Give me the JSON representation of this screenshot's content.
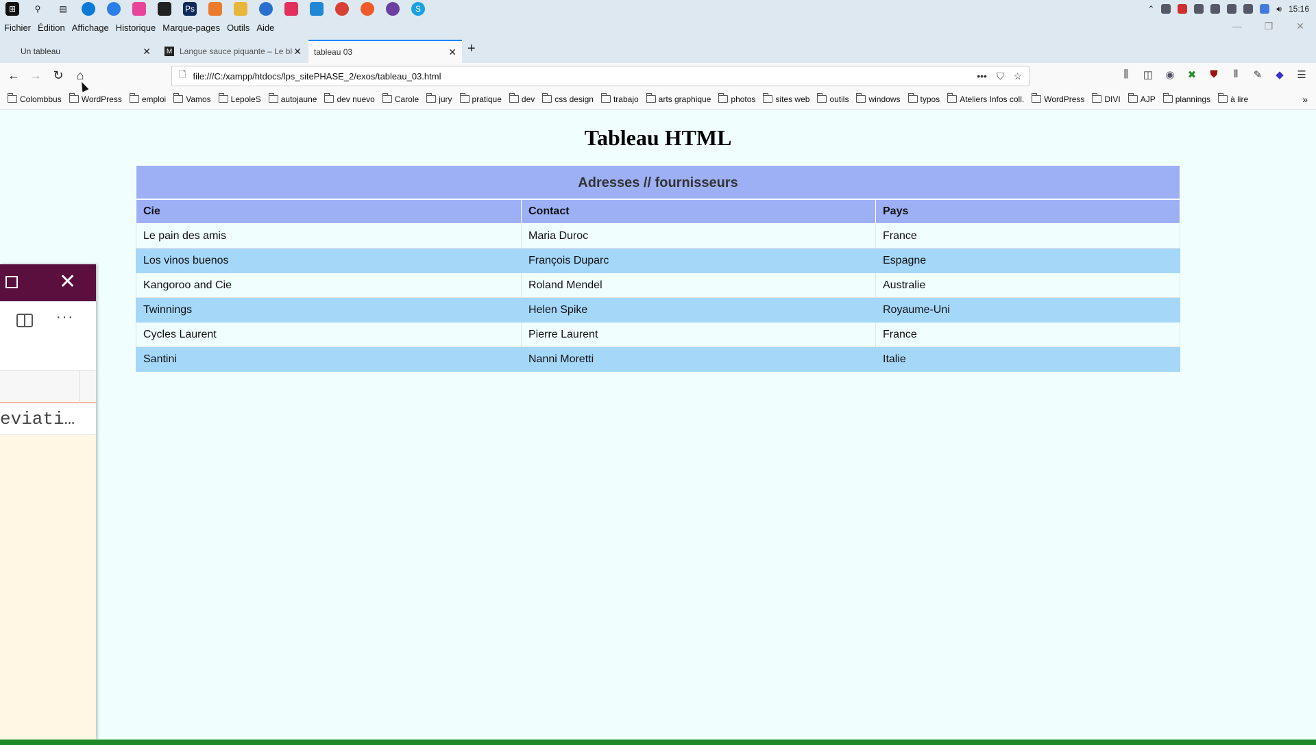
{
  "taskbar": {
    "icons": [
      "windows-start-icon",
      "search-icon",
      "task-view-icon",
      "edge-icon",
      "app-icon-blue",
      "app-icon-pink",
      "acrobat-icon",
      "photoshop-icon",
      "app-icon-orange",
      "file-explorer-icon",
      "github-icon",
      "slack-icon",
      "vscode-icon",
      "chrome-icon",
      "firefox-icon",
      "app-icon-purple",
      "skype-icon"
    ],
    "clock": "15:16"
  },
  "menu": [
    "Fichier",
    "Édition",
    "Affichage",
    "Historique",
    "Marque-pages",
    "Outils",
    "Aide"
  ],
  "tabs": [
    {
      "label": "Un tableau"
    },
    {
      "label": "Langue sauce piquante – Le blo"
    },
    {
      "label": "tableau 03"
    }
  ],
  "url": "file:///C:/xampp/htdocs/lps_sitePHASE_2/exos/tableau_03.html",
  "bookmarks": [
    "Colombbus",
    "WordPress",
    "emploi",
    "Vamos",
    "LepoleS",
    "autojaune",
    "dev nuevo",
    "Carole",
    "jury",
    "pratique",
    "dev",
    "css design",
    "trabajo",
    "arts graphique",
    "photos",
    "sites web",
    "outils",
    "windows",
    "typos",
    "Ateliers Infos coll.",
    "WordPress",
    "DIVI",
    "AJP",
    "plannings",
    "à lire"
  ],
  "page": {
    "title": "Tableau HTML",
    "table": {
      "caption": "Adresses // fournisseurs",
      "headers": [
        "Cie",
        "Contact",
        "Pays"
      ],
      "rows": [
        [
          "Le pain des amis",
          "Maria Duroc",
          "France"
        ],
        [
          "Los vinos buenos",
          "François Duparc",
          "Espagne"
        ],
        [
          "Kangoroo and Cie",
          "Roland Mendel",
          "Australie"
        ],
        [
          "Twinnings",
          "Helen Spike",
          "Royaume-Uni"
        ],
        [
          "Cycles Laurent",
          "Pierre Laurent",
          "France"
        ],
        [
          "Santini",
          "Nanni Moretti",
          "Italie"
        ]
      ]
    }
  },
  "side_window": {
    "text": "eviati…"
  },
  "colors": {
    "page_bg": "#f0fefe",
    "header_bg": "#9db0f6",
    "stripe": "#a5d7f9",
    "side_title": "#5b0f3f"
  }
}
